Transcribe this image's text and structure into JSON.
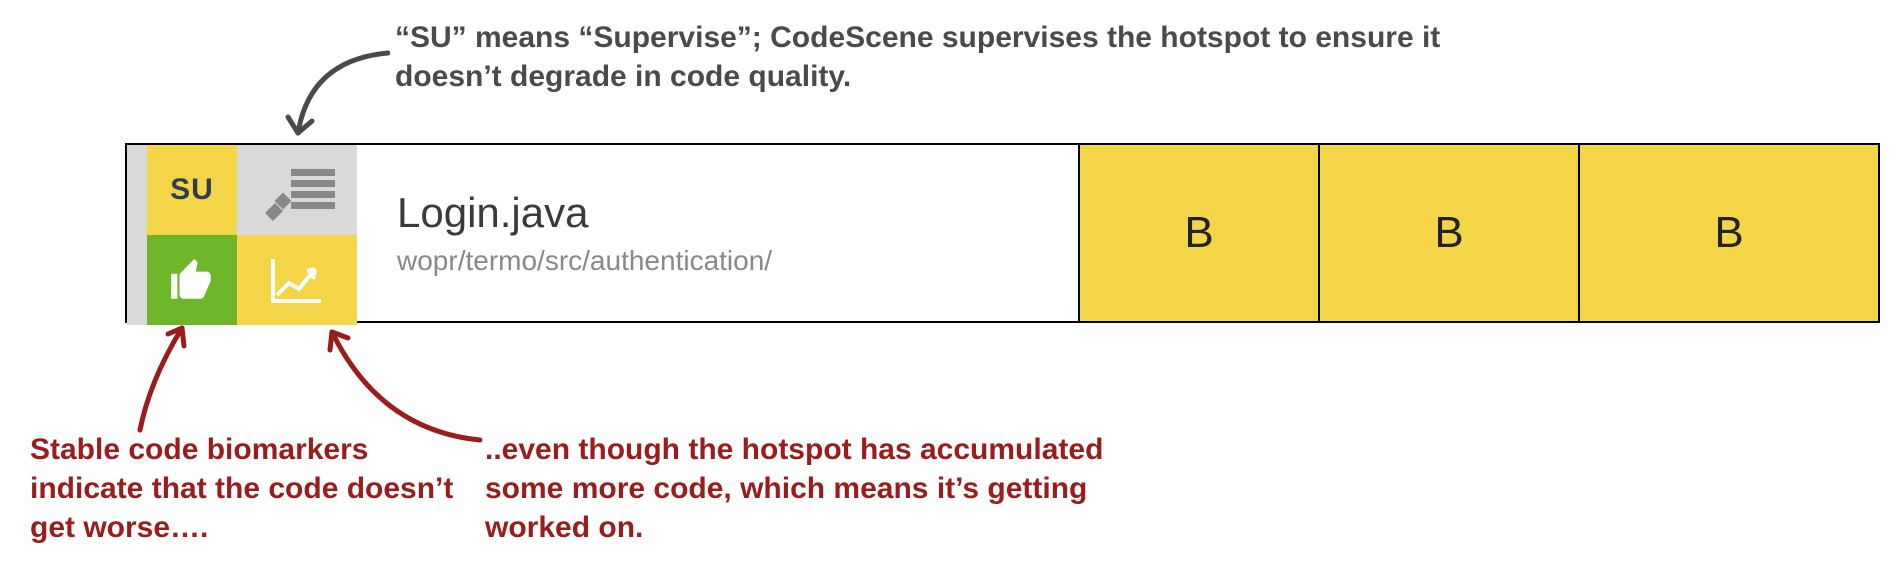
{
  "annotations": {
    "top": "“SU” means “Supervise”; CodeScene supervises the hotspot to ensure it doesn’t degrade in code quality.",
    "bottom_left": "Stable code biomarkers indicate that the code doesn’t get worse….",
    "bottom_right": "..even though the hotspot has accumulated some more code, which means it’s getting worked on."
  },
  "tiles": {
    "su_label": "SU",
    "su_color": "#f5d548",
    "edit_color": "#d9d9d9",
    "thumb_color": "#6eb52a",
    "chart_color": "#f5d548"
  },
  "file": {
    "name": "Login.java",
    "path": "wopr/termo/src/authentication/"
  },
  "grades": {
    "col1": "B",
    "col2": "B",
    "col3": "B"
  },
  "colors": {
    "annotation_dark": "#4a4a4a",
    "annotation_maroon": "#9a1c1c",
    "grade_bg": "#f5d548"
  }
}
